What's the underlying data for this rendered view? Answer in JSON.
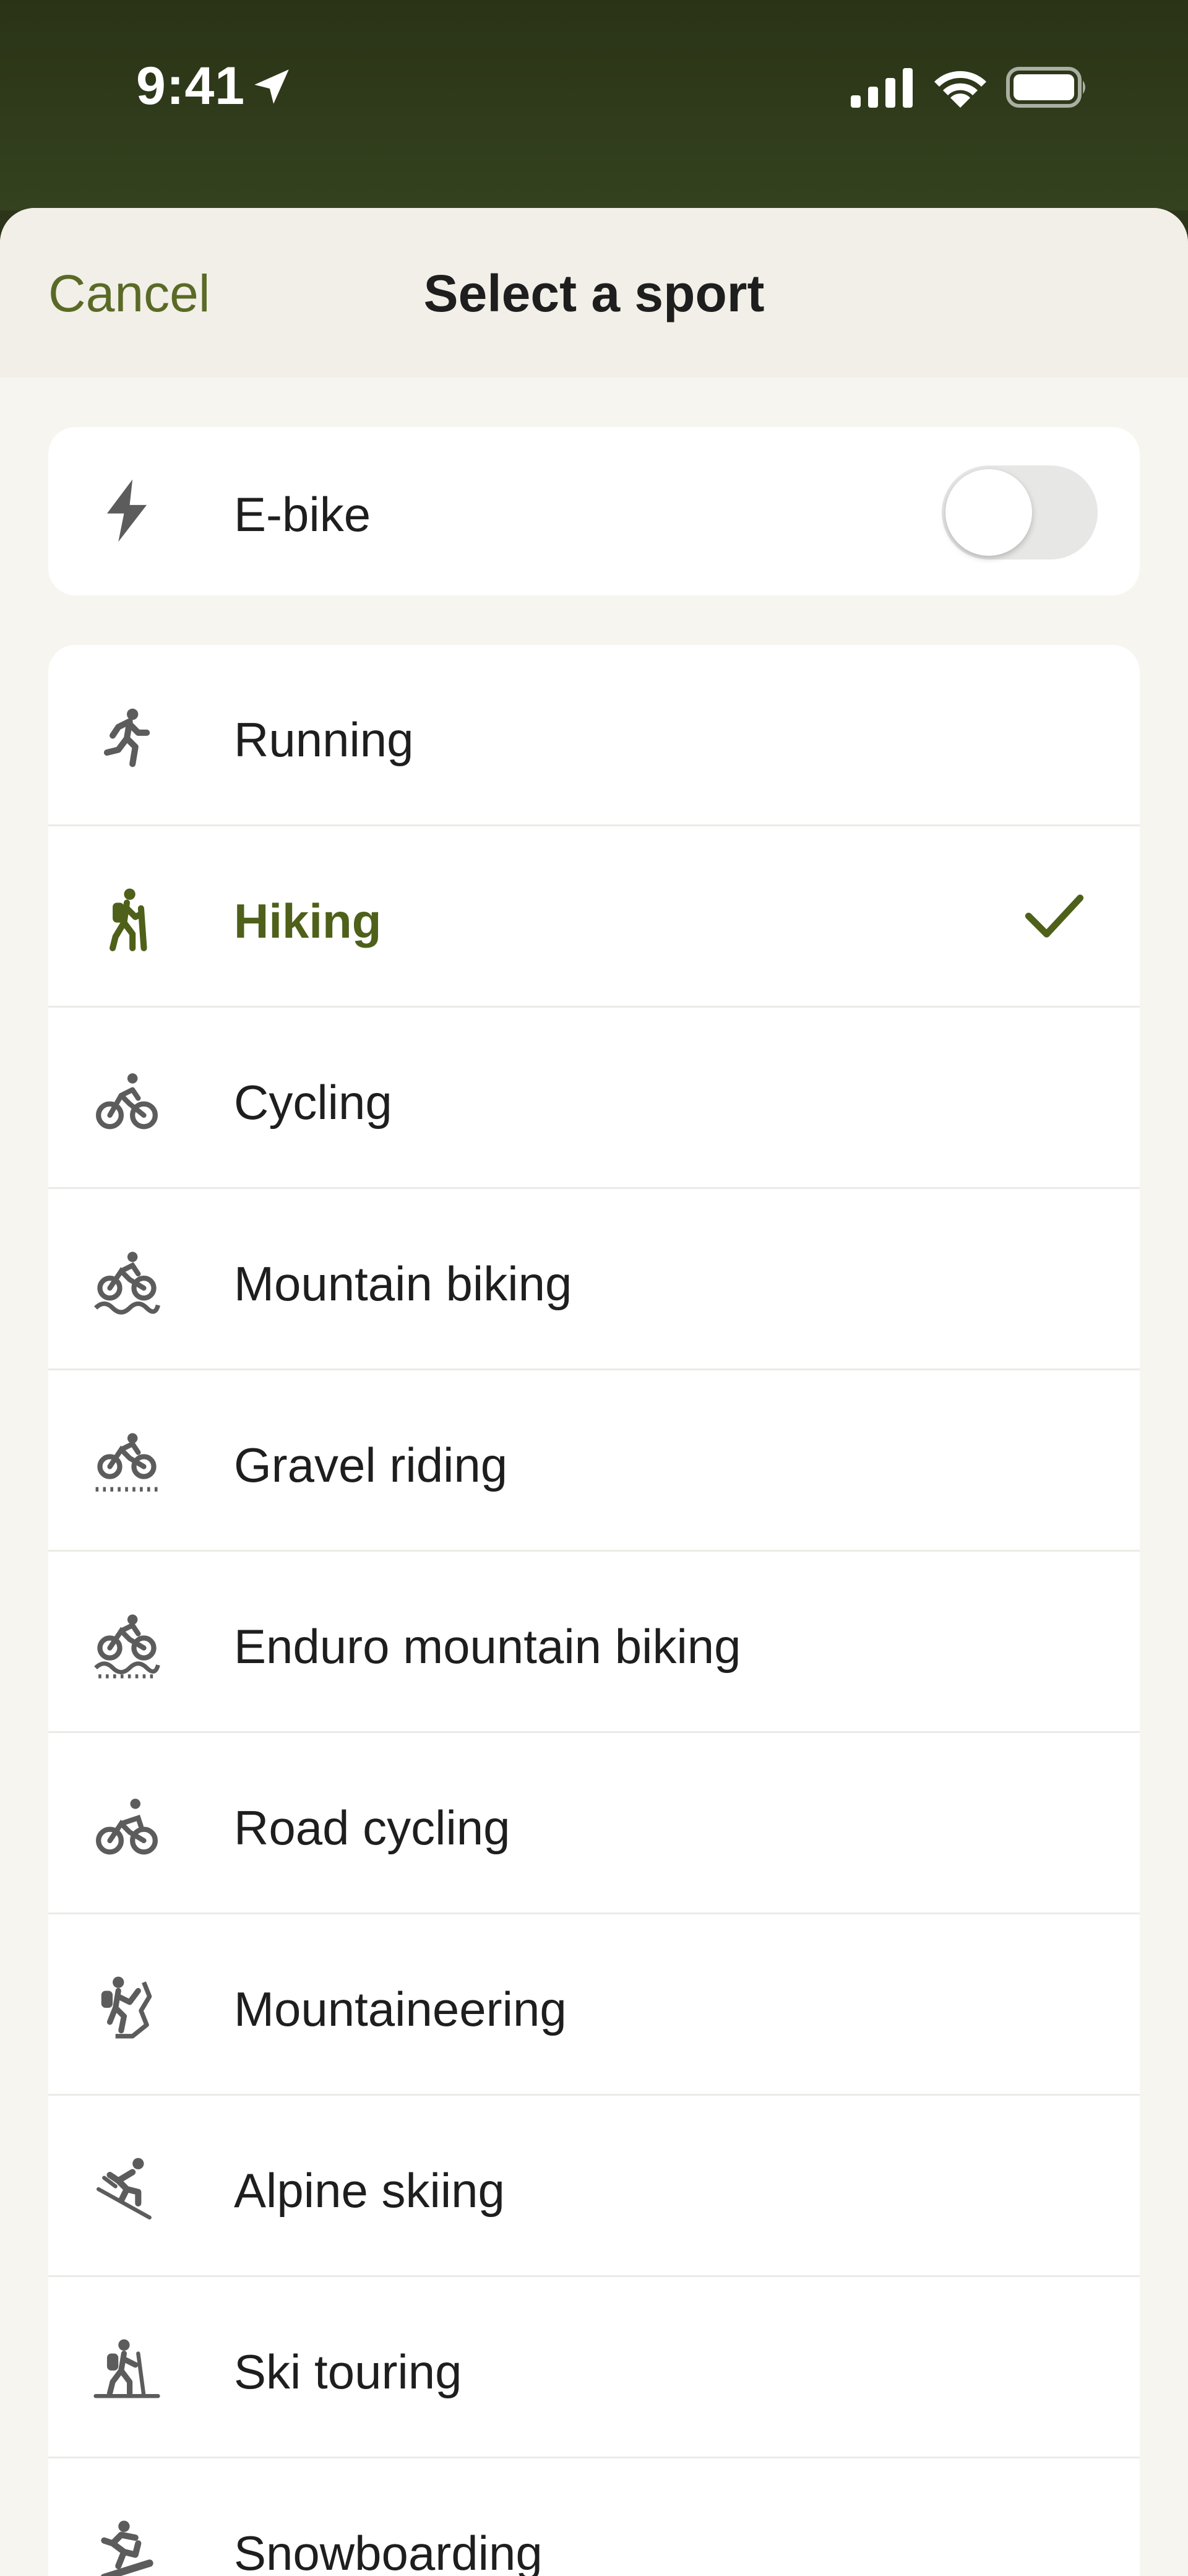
{
  "status_bar": {
    "time": "9:41",
    "icons": [
      "location-arrow-icon",
      "cellular-signal-icon",
      "wifi-icon",
      "battery-icon"
    ]
  },
  "header": {
    "cancel_label": "Cancel",
    "title": "Select a sport"
  },
  "ebike": {
    "label": "E-bike",
    "icon": "lightning-bolt-icon",
    "enabled": false
  },
  "sports": [
    {
      "label": "Running",
      "icon": "running-icon",
      "selected": false
    },
    {
      "label": "Hiking",
      "icon": "hiking-icon",
      "selected": true
    },
    {
      "label": "Cycling",
      "icon": "cycling-icon",
      "selected": false
    },
    {
      "label": "Mountain biking",
      "icon": "mountain-biking-icon",
      "selected": false
    },
    {
      "label": "Gravel riding",
      "icon": "gravel-riding-icon",
      "selected": false
    },
    {
      "label": "Enduro mountain biking",
      "icon": "enduro-biking-icon",
      "selected": false
    },
    {
      "label": "Road cycling",
      "icon": "road-cycling-icon",
      "selected": false
    },
    {
      "label": "Mountaineering",
      "icon": "mountaineering-icon",
      "selected": false
    },
    {
      "label": "Alpine skiing",
      "icon": "alpine-skiing-icon",
      "selected": false
    },
    {
      "label": "Ski touring",
      "icon": "ski-touring-icon",
      "selected": false
    },
    {
      "label": "Snowboarding",
      "icon": "snowboarding-icon",
      "selected": false
    }
  ],
  "colors": {
    "accent": "#5a6a26",
    "status_bar_bg": "#2c3519",
    "sheet_bg": "#f7f5f0",
    "card_bg": "#ffffff"
  }
}
